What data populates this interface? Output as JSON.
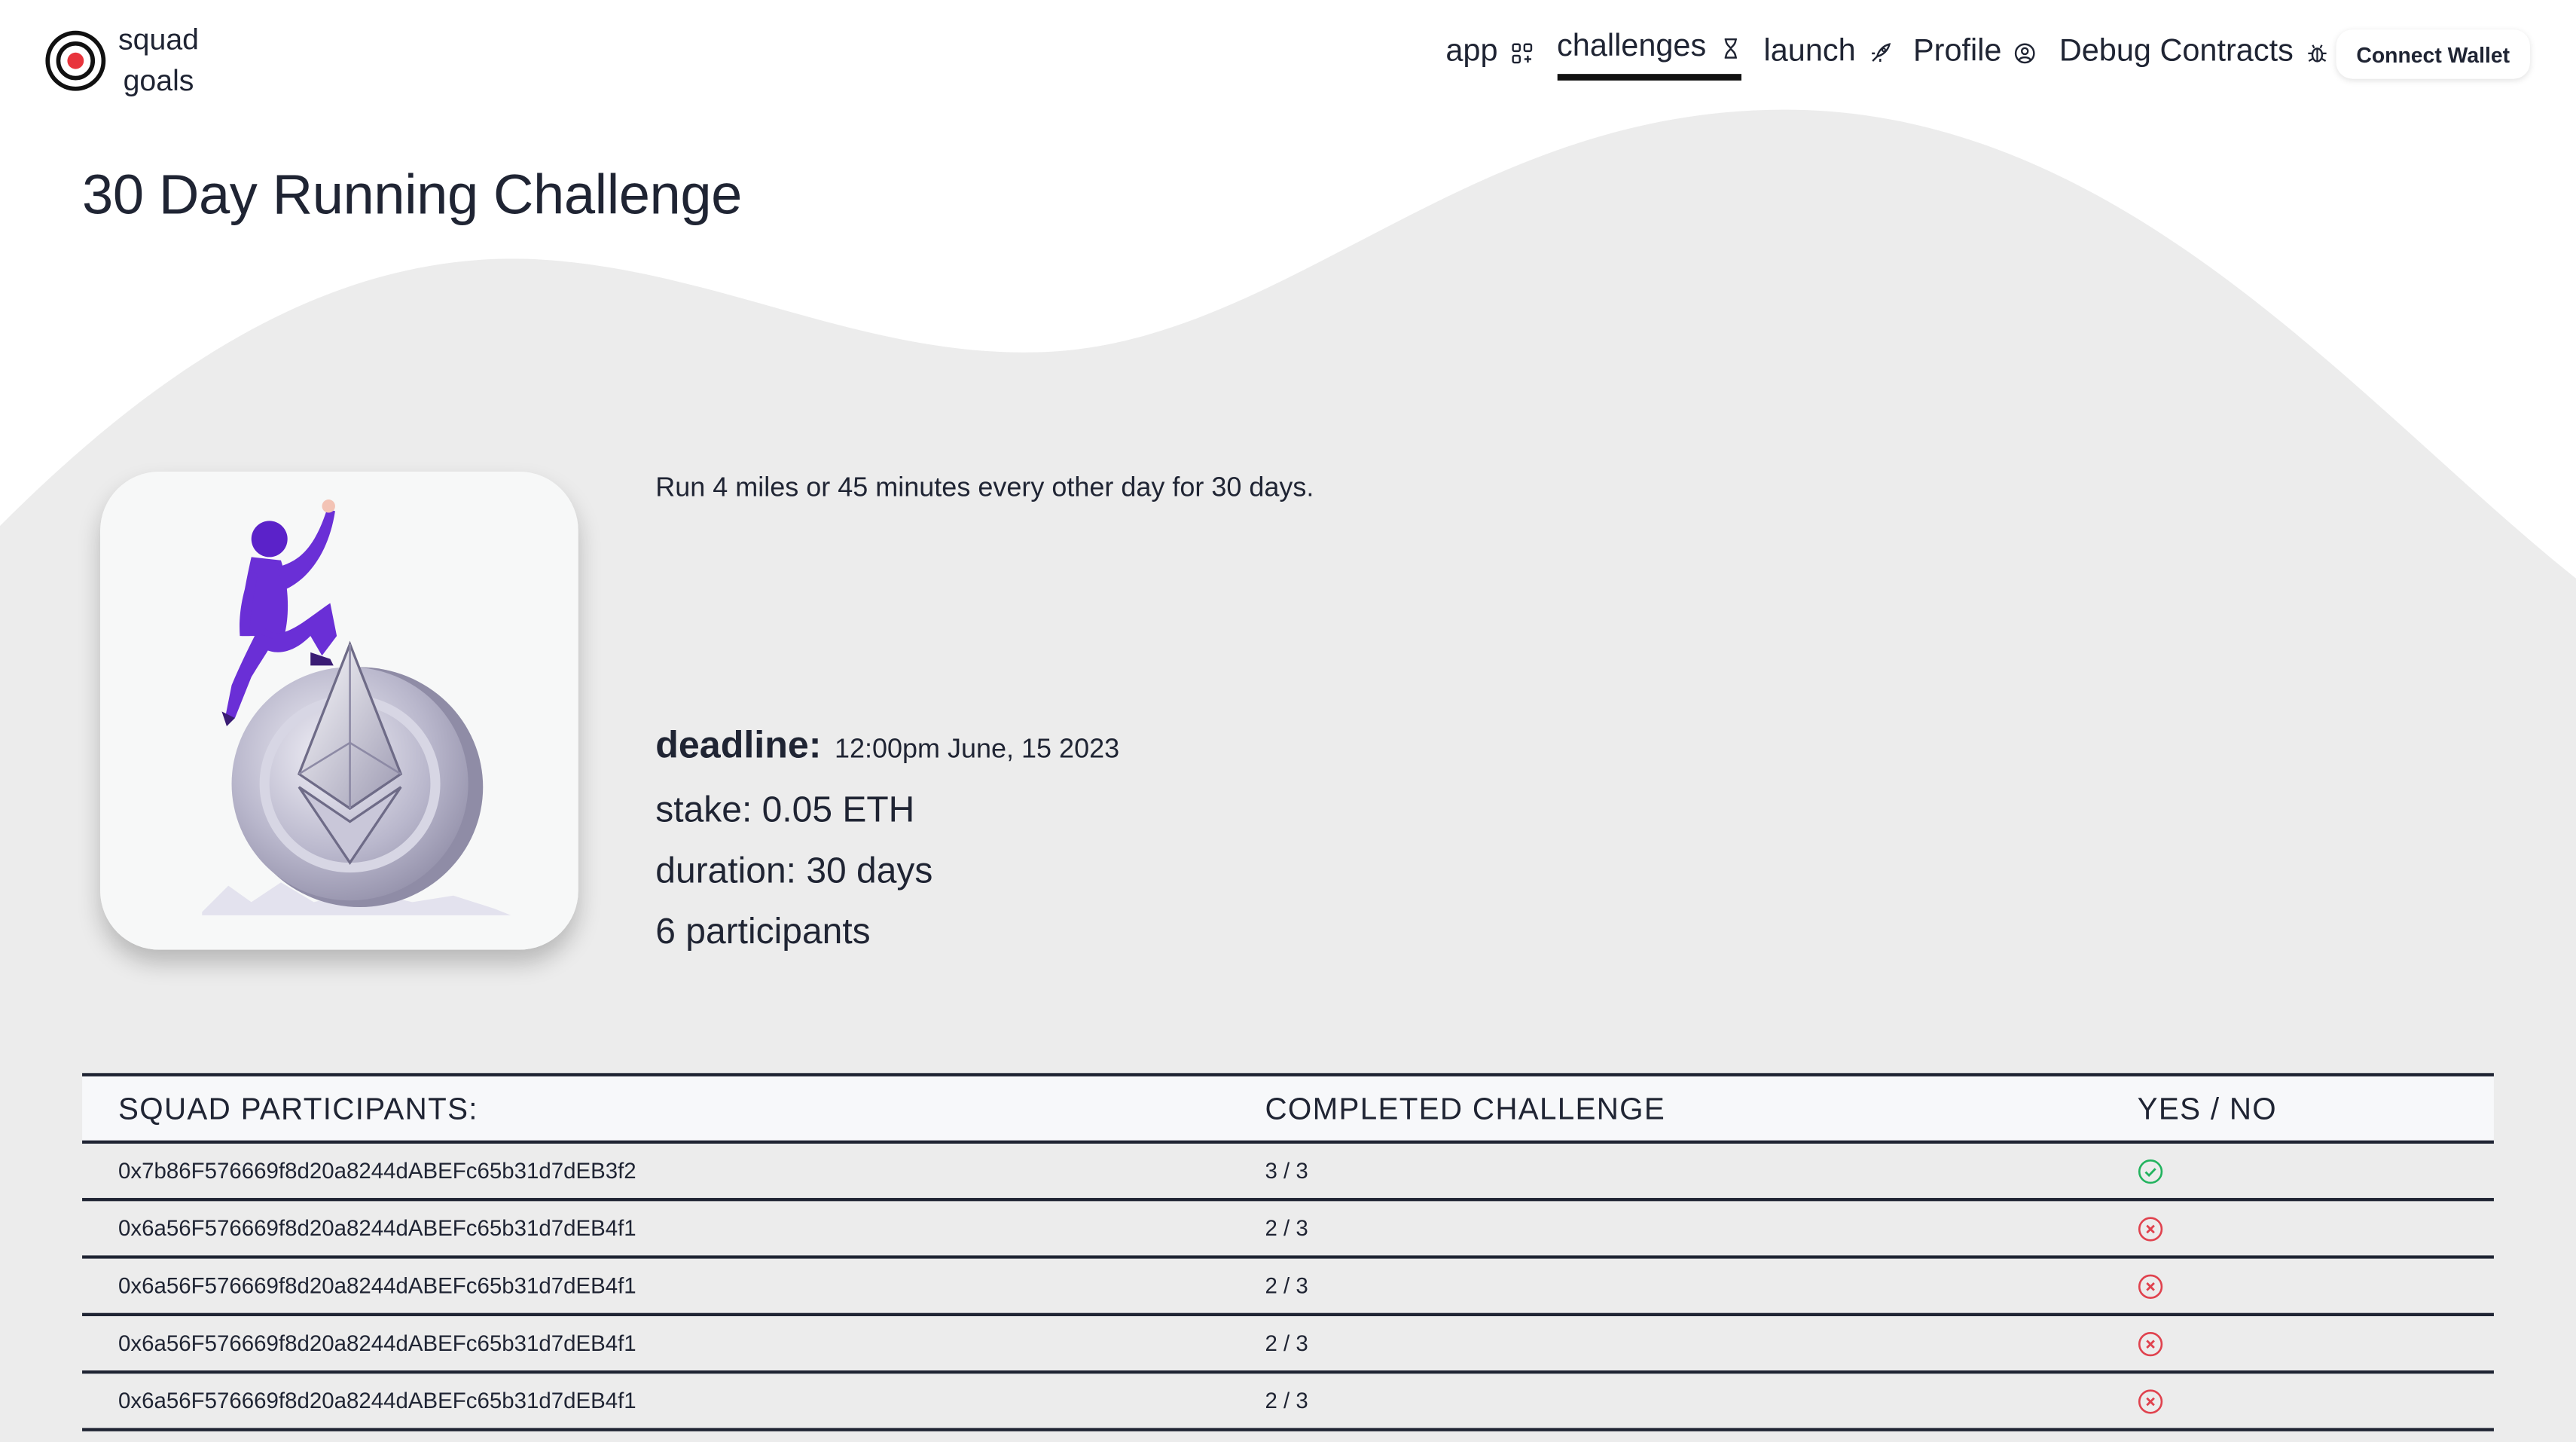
{
  "app": {
    "logo_line1": "squad",
    "logo_line2": "goals"
  },
  "nav": {
    "items": [
      {
        "label": "app",
        "icon": "grid-plus-icon"
      },
      {
        "label": "challenges",
        "icon": "hourglass-icon",
        "active": true
      },
      {
        "label": "launch",
        "icon": "rocket-icon"
      },
      {
        "label": "Profile",
        "icon": "user-circle-icon"
      },
      {
        "label": "Debug Contracts",
        "icon": "bug-icon"
      }
    ],
    "connect_wallet": "Connect Wallet"
  },
  "challenge": {
    "title": "30 Day Running Challenge",
    "description": "Run 4 miles or 45 minutes every other day for 30 days.",
    "deadline_label": "deadline:",
    "deadline_value": "12:00pm June, 15 2023",
    "stake": "stake: 0.05 ETH",
    "duration": "duration: 30 days",
    "participants": "6 participants"
  },
  "table": {
    "headers": [
      "SQUAD PARTICIPANTS:",
      "COMPLETED CHALLENGE",
      "YES / NO"
    ],
    "rows": [
      {
        "address": "0x7b86F576669f8d20a8244dABEFc65b31d7dEB3f2",
        "completed": "3 / 3",
        "status": "yes"
      },
      {
        "address": "0x6a56F576669f8d20a8244dABEFc65b31d7dEB4f1",
        "completed": "2 / 3",
        "status": "no"
      },
      {
        "address": "0x6a56F576669f8d20a8244dABEFc65b31d7dEB4f1",
        "completed": "2 / 3",
        "status": "no"
      },
      {
        "address": "0x6a56F576669f8d20a8244dABEFc65b31d7dEB4f1",
        "completed": "2 / 3",
        "status": "no"
      },
      {
        "address": "0x6a56F576669f8d20a8244dABEFc65b31d7dEB4f1",
        "completed": "2 / 3",
        "status": "no"
      }
    ]
  },
  "colors": {
    "background_wave": "#ececec",
    "text": "#1f2433",
    "yes": "#22b35e",
    "no": "#e0424e",
    "logo_accent": "#e8343c"
  }
}
